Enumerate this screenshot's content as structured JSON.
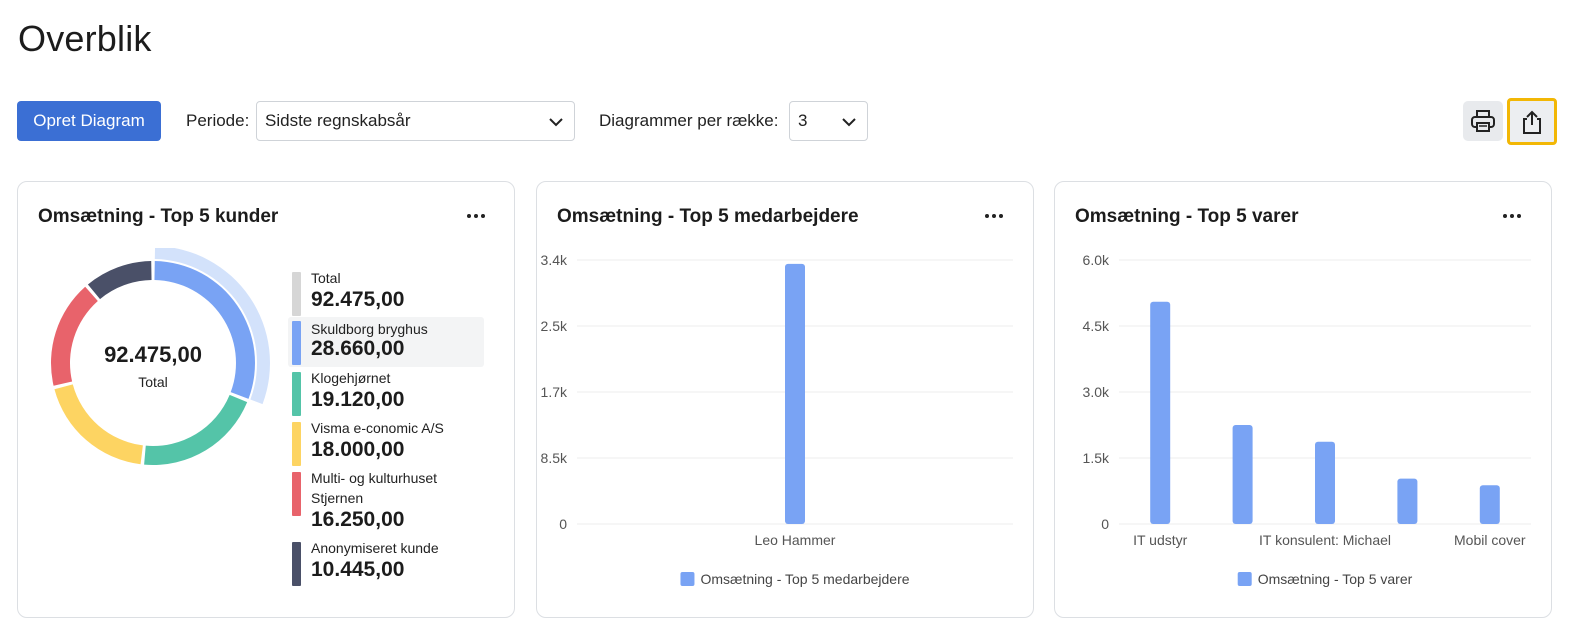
{
  "page": {
    "title": "Overblik"
  },
  "toolbar": {
    "create_label": "Opret Diagram",
    "period_label": "Periode:",
    "period_value": "Sidste regnskabsår",
    "per_row_label": "Diagrammer per række:",
    "per_row_value": "3"
  },
  "cards": [
    {
      "title": "Omsætning - Top 5 kunder",
      "center_value": "92.475,00",
      "center_label": "Total",
      "legend": [
        {
          "label": "Total",
          "value": "92.475,00",
          "color": "#d6d6d6"
        },
        {
          "label": "Skuldborg bryghus",
          "value": "28.660,00",
          "color": "#79a3f4"
        },
        {
          "label": "Klogehjørnet",
          "value": "19.120,00",
          "color": "#54c4a8"
        },
        {
          "label": "Visma e-conomic A/S",
          "value": "18.000,00",
          "color": "#fdd462"
        },
        {
          "label": "Multi- og kulturhuset Stjernen",
          "value": "16.250,00",
          "color": "#e8636b"
        },
        {
          "label": "Anonymiseret kunde",
          "value": "10.445,00",
          "color": "#4a5068"
        }
      ]
    },
    {
      "title": "Omsætning - Top 5 medarbejdere"
    },
    {
      "title": "Omsætning - Top 5 varer"
    }
  ],
  "chart_data": [
    {
      "type": "pie",
      "title": "Omsætning - Top 5 kunder",
      "categories": [
        "Skuldborg bryghus",
        "Klogehjørnet",
        "Visma e-conomic A/S",
        "Multi- og kulturhuset Stjernen",
        "Anonymiseret kunde"
      ],
      "values": [
        28660,
        19120,
        18000,
        16250,
        10445
      ],
      "colors": [
        "#79a3f4",
        "#54c4a8",
        "#fdd462",
        "#e8636b",
        "#4a5068"
      ],
      "highlight_index": 0,
      "highlight_color": "#d3e2fb"
    },
    {
      "type": "bar",
      "title": "Omsætning - Top 5 medarbejdere",
      "categories": [
        "Leo Hammer"
      ],
      "values": [
        3350
      ],
      "ylim": [
        0,
        3400
      ],
      "yticks": [
        0,
        850,
        1700,
        2550,
        3400
      ],
      "ytick_labels": [
        "0",
        "8.5k",
        "1.7k",
        "2.5k",
        "3.4k"
      ],
      "series_name": "Omsætning - Top 5 medarbejdere",
      "color": "#79a3f4",
      "grid": true,
      "legend": "bottom"
    },
    {
      "type": "bar",
      "title": "Omsætning - Top 5 varer",
      "categories": [
        "IT udstyr",
        "",
        "IT konsulent: Michael",
        "",
        "Mobil cover"
      ],
      "values": [
        5050,
        2250,
        1870,
        1030,
        880
      ],
      "ylim": [
        0,
        6000
      ],
      "yticks": [
        0,
        1500,
        3000,
        4500,
        6000
      ],
      "ytick_labels": [
        "0",
        "1.5k",
        "3.0k",
        "4.5k",
        "6.0k"
      ],
      "series_name": "Omsætning - Top 5 varer",
      "color": "#79a3f4",
      "grid": true,
      "legend": "bottom"
    }
  ]
}
